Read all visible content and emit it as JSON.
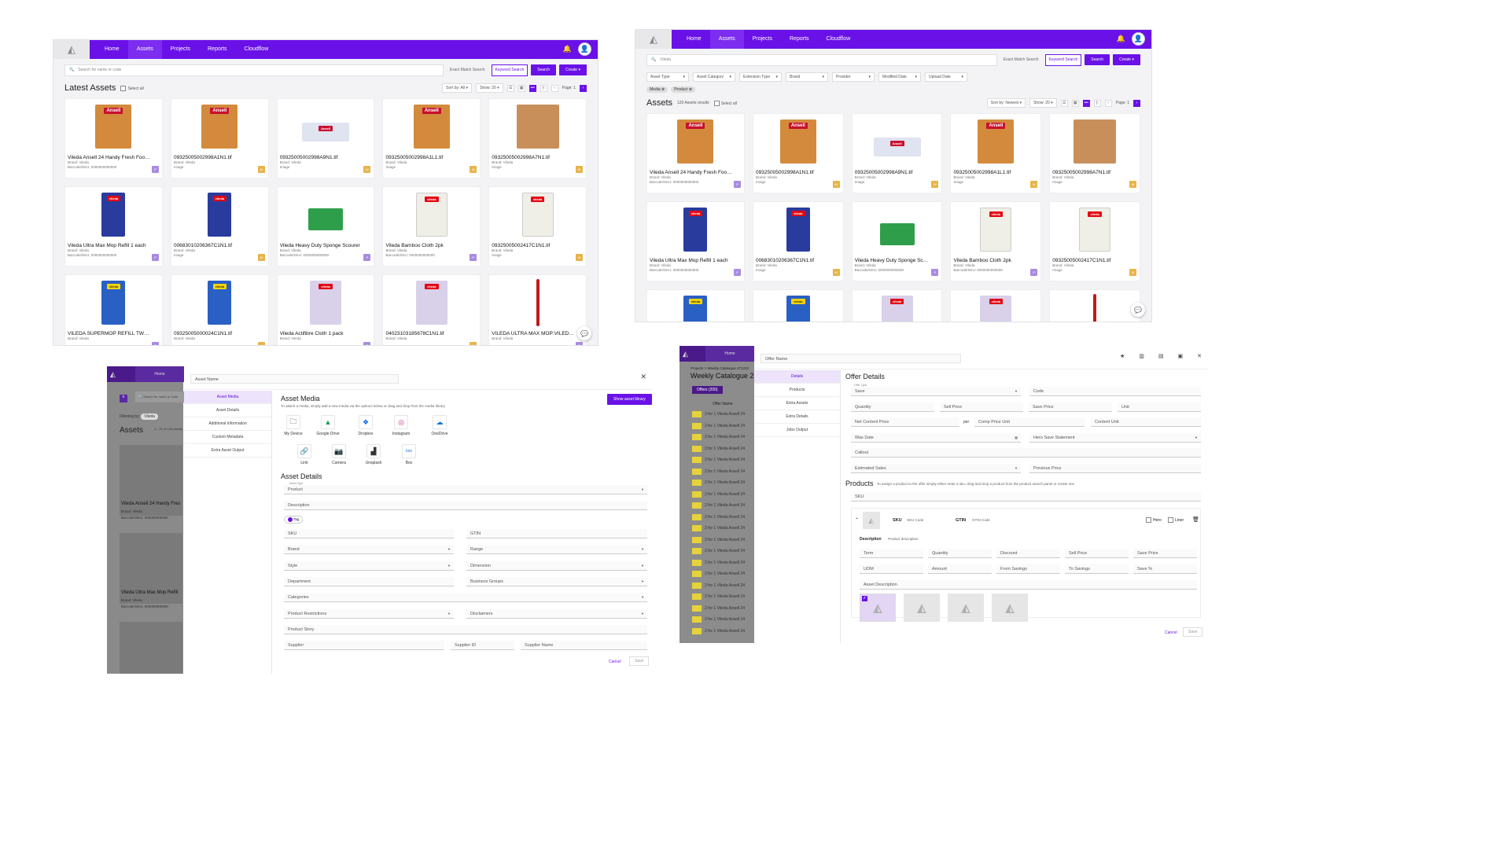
{
  "nav": {
    "items": [
      "Home",
      "Assets",
      "Projects",
      "Reports",
      "Cloudflow"
    ],
    "active": "Assets"
  },
  "panel1": {
    "search_placeholder": "Search for name or code",
    "exact_match": "Exact Match Search",
    "keyword": "Keyword Search",
    "search_btn": "Search",
    "create_btn": "Create",
    "title": "Latest Assets",
    "select_all": "Select all",
    "sort": "Sort by: All",
    "show": "Show: 20",
    "page": "Page: 1",
    "cards": [
      {
        "name": "Vileda Ansell 24 Handy Fresh Food Sa...",
        "brand": "Brand: Vileda",
        "meta": "Barcode/SKU: 0000000000000",
        "badge": "P",
        "kind": "ansell"
      },
      {
        "name": "09325005002998A1N1.tif",
        "brand": "Brand: Vileda",
        "meta": "Image",
        "badge": "M",
        "kind": "ansell"
      },
      {
        "name": "09325005002998A9N1.tif",
        "brand": "Brand: Vileda",
        "meta": "Image",
        "badge": "M",
        "kind": "tube"
      },
      {
        "name": "09325005002998A1L1.tif",
        "brand": "Brand: Vileda",
        "meta": "Image",
        "badge": "M",
        "kind": "ansell"
      },
      {
        "name": "09325005002998A7N1.tif",
        "brand": "Brand: Vileda",
        "meta": "Image",
        "badge": "M",
        "kind": "back"
      },
      {
        "name": "Vileda Ultra Max Mop Refill 1 each",
        "brand": "Brand: Vileda",
        "meta": "Barcode/SKU: 0000000000000",
        "badge": "P",
        "kind": "mop"
      },
      {
        "name": "00683010206367C1N1.tif",
        "brand": "Brand: Vileda",
        "meta": "Image",
        "badge": "M",
        "kind": "mop"
      },
      {
        "name": "Vileda Heavy Duty Sponge Scourer",
        "brand": "Brand: Vileda",
        "meta": "Barcode/SKU: 0000000000000",
        "badge": "P",
        "kind": "sponge"
      },
      {
        "name": "Vileda Bamboo Cloth 2pk",
        "brand": "Brand: Vileda",
        "meta": "Barcode/SKU: 0000000000000",
        "badge": "P",
        "kind": "cloth"
      },
      {
        "name": "09325005002417C1N1.tif",
        "brand": "Brand: Vileda",
        "meta": "Image",
        "badge": "M",
        "kind": "cloth"
      },
      {
        "name": "VILEDA SUPERMOP REFILL TWIN...",
        "brand": "Brand: Vileda",
        "meta": "",
        "badge": "P",
        "kind": "refill"
      },
      {
        "name": "09325005000024C1N1.tif",
        "brand": "Brand: Vileda",
        "meta": "",
        "badge": "M",
        "kind": "refill"
      },
      {
        "name": "Vileda Actifibre Cloth 1 pack",
        "brand": "Brand: Vileda",
        "meta": "",
        "badge": "P",
        "kind": "acti"
      },
      {
        "name": "04023103185678C1N1.tif",
        "brand": "Brand: Vileda",
        "meta": "",
        "badge": "M",
        "kind": "acti"
      },
      {
        "name": "VILEDA ULTRA MAX MOP:VILEDA...",
        "brand": "Brand: Vileda",
        "meta": "",
        "badge": "P",
        "kind": "stick"
      }
    ]
  },
  "panel2": {
    "search_value": "Vileda",
    "filters": [
      "Asset Type",
      "Asset Category",
      "Extension Type",
      "Brand",
      "Provider",
      "Modified Date",
      "Upload Date"
    ],
    "chips": [
      "Media",
      "Product"
    ],
    "title": "Assets",
    "results": "120 Assets results",
    "select_all": "Select all",
    "sort": "Sort by: Newest",
    "show": "Show: 20",
    "page": "Page: 1",
    "names": [
      "Vileda Ansell 24 Handy Fresh Food Sa...",
      "09325005002998A1N1.tif",
      "09325005002998A9N1.tif",
      "09325005002998A1L1.tif",
      "09325005002998A7N1.tif",
      "Vileda Ultra Max Mop Refill 1 each",
      "00683010206367C1N1.tif",
      "Vileda Heavy Duty Sponge Scourer",
      "Vileda Bamboo Cloth 2pk",
      "09325005002417C1N1.tif"
    ]
  },
  "panel3": {
    "asset_name": "Asset Name",
    "home": "Home",
    "search_placeholder": "Search for name or code",
    "filtering": "Filtering by:",
    "filter_chip": "Vileda",
    "assets_title": "Assets",
    "assets_count": "1 - 20 of 120 Assets",
    "bg_cards": [
      {
        "name": "Vileda Ansell 24 Handy Fres",
        "brand": "Brand: Vileda",
        "meta": "Barcode/SKU: 000000000000"
      },
      {
        "name": "Vileda Ultra Max Mop Refill",
        "brand": "Brand: Vileda",
        "meta": "Barcode/SKU: 000000000000"
      }
    ],
    "side": [
      "Asset Media",
      "Asset Details",
      "Additional Information",
      "Custom Metadata",
      "Extra Asset Output"
    ],
    "media_title": "Asset Media",
    "media_sub": "To attach a media, simply add a new media via the options below or drag and drop from the media library",
    "show_library": "Show asset library",
    "sources": [
      "My Device",
      "Google Drive",
      "Dropbox",
      "Instagram",
      "OneDrive",
      "Link",
      "Camera",
      "Unsplash",
      "Box"
    ],
    "details_title": "Asset Details",
    "asset_type_label": "Asset Type",
    "asset_type": "Product",
    "description": "Description",
    "tag": "Tag",
    "fields": [
      "SKU",
      "GTIN",
      "Brand",
      "Range",
      "Style",
      "Dimension",
      "Department",
      "Business Groups",
      "Categories",
      "Product Restrictions",
      "Disclaimers",
      "Product Story",
      "Supplier",
      "Supplier ID",
      "Supplier Name"
    ],
    "cancel": "Cancel",
    "save": "Save"
  },
  "panel4": {
    "offer_name": "Offer Name",
    "home": "Home",
    "breadcrumb": "Projects > Weekly Catalogue 271222",
    "catalogue": "Weekly Catalogue 2",
    "offers_tab": "Offers (200)",
    "offer_col": "Offer Name",
    "offer_row": "2 for 1 Vileda Ansell 24",
    "side": [
      "Details",
      "Products",
      "Extra Assets",
      "Extra Details",
      "Jobs Output"
    ],
    "title": "Offer Details",
    "offer_type_label": "Offer Type",
    "offer_type": "Save",
    "code": "Code",
    "quantity": "Quantity",
    "sell_price": "Sell Price",
    "save_price": "Save Price",
    "unit": "Unit",
    "net_content_price": "Net Content Price",
    "per": "per",
    "comp_price_unit": "Comp Price Unit",
    "content_unit": "Content Unit",
    "was_date": "Was Date",
    "hero_save": "Hero Save Statement",
    "callout": "Callout",
    "est_sales": "Estimated Sales",
    "prev_price": "Previous Price",
    "products_title": "Products",
    "products_sub": "To assign a product to the offer simply either enter a sku, drag and drop a product from the product search panel or create one",
    "sku": "SKU",
    "sku_label": "SKU",
    "sku_code": "SKU Code",
    "gtin_label": "GTIN",
    "gtin_code": "GTIN Code",
    "hero": "Hero",
    "liner": "Liner",
    "desc_label": "Description",
    "desc_value": "Product description",
    "grid1": [
      "Term",
      "Quantity",
      "Discount",
      "Sell Price",
      "Save Price"
    ],
    "grid2": [
      "UOM",
      "Amount",
      "From Savings",
      "To Savings",
      "Save %"
    ],
    "asset_desc": "Asset Description",
    "cancel": "Cancel",
    "save": "Save"
  }
}
